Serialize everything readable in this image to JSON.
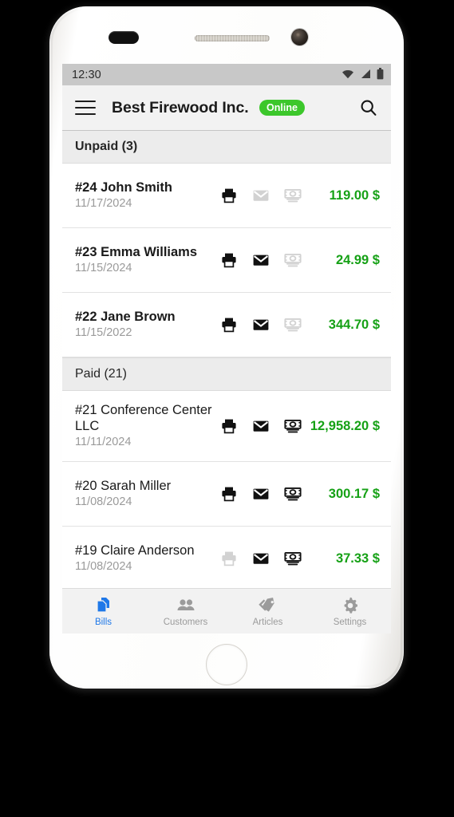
{
  "status_bar": {
    "clock": "12:30",
    "icons": [
      "wifi-icon",
      "cellular-signal-icon",
      "battery-icon"
    ]
  },
  "app_bar": {
    "menu_icon": "hamburger-menu-icon",
    "title": "Best Firewood Inc.",
    "status_badge": "Online",
    "badge_color": "#3cc72b",
    "search_icon": "search-icon"
  },
  "sections": [
    {
      "label": "Unpaid (3)",
      "bold": true,
      "rows": [
        {
          "name": "#24 John Smith",
          "date": "11/17/2024",
          "amount": "119.00 $",
          "print": "active",
          "mail": "inactive",
          "cash": "inactive"
        },
        {
          "name": "#23 Emma Williams",
          "date": "11/15/2024",
          "amount": "24.99 $",
          "print": "active",
          "mail": "active",
          "cash": "inactive"
        },
        {
          "name": "#22 Jane Brown",
          "date": "11/15/2022",
          "amount": "344.70 $",
          "print": "active",
          "mail": "active",
          "cash": "inactive"
        }
      ]
    },
    {
      "label": "Paid (21)",
      "bold": false,
      "rows": [
        {
          "name": "#21 Conference Center LLC",
          "date": "11/11/2024",
          "amount": "12,958.20 $",
          "print": "active",
          "mail": "active",
          "cash": "active"
        },
        {
          "name": "#20 Sarah Miller",
          "date": "11/08/2024",
          "amount": "300.17 $",
          "print": "active",
          "mail": "active",
          "cash": "active"
        },
        {
          "name": "#19 Claire Anderson",
          "date": "11/08/2024",
          "amount": "37.33 $",
          "print": "inactive",
          "mail": "active",
          "cash": "active"
        }
      ]
    }
  ],
  "fab": {
    "icon": "plus-icon",
    "color": "#1565d8"
  },
  "bottom_nav": {
    "items": [
      {
        "label": "Bills",
        "icon": "documents-stack-icon",
        "active": true
      },
      {
        "label": "Customers",
        "icon": "people-icon",
        "active": false
      },
      {
        "label": "Articles",
        "icon": "tags-icon",
        "active": false
      },
      {
        "label": "Settings",
        "icon": "gear-icon",
        "active": false
      }
    ],
    "active_color": "#1f78e8"
  },
  "amount_color": "#16a116",
  "row_icons": {
    "print": "printer-icon",
    "mail": "envelope-icon",
    "cash": "money-stack-icon"
  }
}
